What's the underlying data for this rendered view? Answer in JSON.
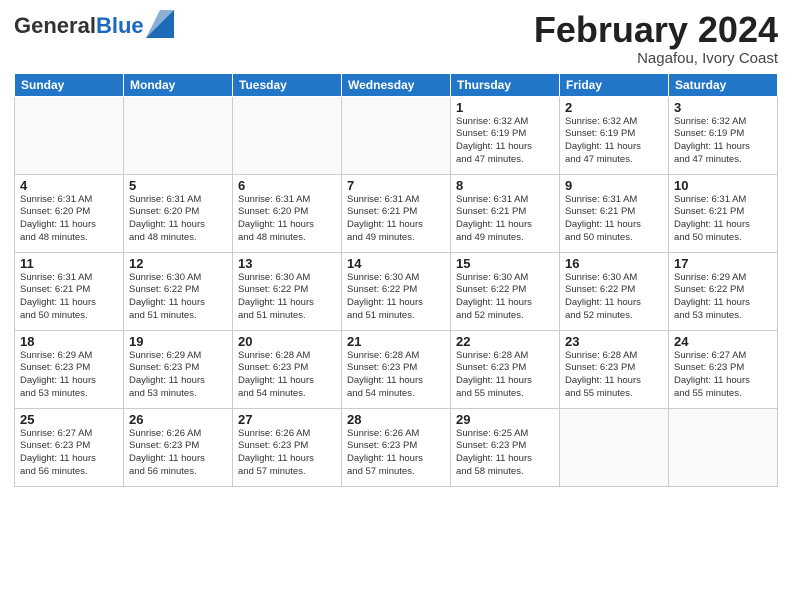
{
  "header": {
    "title": "February 2024",
    "subtitle": "Nagafou, Ivory Coast",
    "logo_general": "General",
    "logo_blue": "Blue"
  },
  "days_of_week": [
    "Sunday",
    "Monday",
    "Tuesday",
    "Wednesday",
    "Thursday",
    "Friday",
    "Saturday"
  ],
  "weeks": [
    [
      {
        "day": "",
        "info": ""
      },
      {
        "day": "",
        "info": ""
      },
      {
        "day": "",
        "info": ""
      },
      {
        "day": "",
        "info": ""
      },
      {
        "day": "1",
        "info": "Sunrise: 6:32 AM\nSunset: 6:19 PM\nDaylight: 11 hours\nand 47 minutes."
      },
      {
        "day": "2",
        "info": "Sunrise: 6:32 AM\nSunset: 6:19 PM\nDaylight: 11 hours\nand 47 minutes."
      },
      {
        "day": "3",
        "info": "Sunrise: 6:32 AM\nSunset: 6:19 PM\nDaylight: 11 hours\nand 47 minutes."
      }
    ],
    [
      {
        "day": "4",
        "info": "Sunrise: 6:31 AM\nSunset: 6:20 PM\nDaylight: 11 hours\nand 48 minutes."
      },
      {
        "day": "5",
        "info": "Sunrise: 6:31 AM\nSunset: 6:20 PM\nDaylight: 11 hours\nand 48 minutes."
      },
      {
        "day": "6",
        "info": "Sunrise: 6:31 AM\nSunset: 6:20 PM\nDaylight: 11 hours\nand 48 minutes."
      },
      {
        "day": "7",
        "info": "Sunrise: 6:31 AM\nSunset: 6:21 PM\nDaylight: 11 hours\nand 49 minutes."
      },
      {
        "day": "8",
        "info": "Sunrise: 6:31 AM\nSunset: 6:21 PM\nDaylight: 11 hours\nand 49 minutes."
      },
      {
        "day": "9",
        "info": "Sunrise: 6:31 AM\nSunset: 6:21 PM\nDaylight: 11 hours\nand 50 minutes."
      },
      {
        "day": "10",
        "info": "Sunrise: 6:31 AM\nSunset: 6:21 PM\nDaylight: 11 hours\nand 50 minutes."
      }
    ],
    [
      {
        "day": "11",
        "info": "Sunrise: 6:31 AM\nSunset: 6:21 PM\nDaylight: 11 hours\nand 50 minutes."
      },
      {
        "day": "12",
        "info": "Sunrise: 6:30 AM\nSunset: 6:22 PM\nDaylight: 11 hours\nand 51 minutes."
      },
      {
        "day": "13",
        "info": "Sunrise: 6:30 AM\nSunset: 6:22 PM\nDaylight: 11 hours\nand 51 minutes."
      },
      {
        "day": "14",
        "info": "Sunrise: 6:30 AM\nSunset: 6:22 PM\nDaylight: 11 hours\nand 51 minutes."
      },
      {
        "day": "15",
        "info": "Sunrise: 6:30 AM\nSunset: 6:22 PM\nDaylight: 11 hours\nand 52 minutes."
      },
      {
        "day": "16",
        "info": "Sunrise: 6:30 AM\nSunset: 6:22 PM\nDaylight: 11 hours\nand 52 minutes."
      },
      {
        "day": "17",
        "info": "Sunrise: 6:29 AM\nSunset: 6:22 PM\nDaylight: 11 hours\nand 53 minutes."
      }
    ],
    [
      {
        "day": "18",
        "info": "Sunrise: 6:29 AM\nSunset: 6:23 PM\nDaylight: 11 hours\nand 53 minutes."
      },
      {
        "day": "19",
        "info": "Sunrise: 6:29 AM\nSunset: 6:23 PM\nDaylight: 11 hours\nand 53 minutes."
      },
      {
        "day": "20",
        "info": "Sunrise: 6:28 AM\nSunset: 6:23 PM\nDaylight: 11 hours\nand 54 minutes."
      },
      {
        "day": "21",
        "info": "Sunrise: 6:28 AM\nSunset: 6:23 PM\nDaylight: 11 hours\nand 54 minutes."
      },
      {
        "day": "22",
        "info": "Sunrise: 6:28 AM\nSunset: 6:23 PM\nDaylight: 11 hours\nand 55 minutes."
      },
      {
        "day": "23",
        "info": "Sunrise: 6:28 AM\nSunset: 6:23 PM\nDaylight: 11 hours\nand 55 minutes."
      },
      {
        "day": "24",
        "info": "Sunrise: 6:27 AM\nSunset: 6:23 PM\nDaylight: 11 hours\nand 55 minutes."
      }
    ],
    [
      {
        "day": "25",
        "info": "Sunrise: 6:27 AM\nSunset: 6:23 PM\nDaylight: 11 hours\nand 56 minutes."
      },
      {
        "day": "26",
        "info": "Sunrise: 6:26 AM\nSunset: 6:23 PM\nDaylight: 11 hours\nand 56 minutes."
      },
      {
        "day": "27",
        "info": "Sunrise: 6:26 AM\nSunset: 6:23 PM\nDaylight: 11 hours\nand 57 minutes."
      },
      {
        "day": "28",
        "info": "Sunrise: 6:26 AM\nSunset: 6:23 PM\nDaylight: 11 hours\nand 57 minutes."
      },
      {
        "day": "29",
        "info": "Sunrise: 6:25 AM\nSunset: 6:23 PM\nDaylight: 11 hours\nand 58 minutes."
      },
      {
        "day": "",
        "info": ""
      },
      {
        "day": "",
        "info": ""
      }
    ]
  ]
}
